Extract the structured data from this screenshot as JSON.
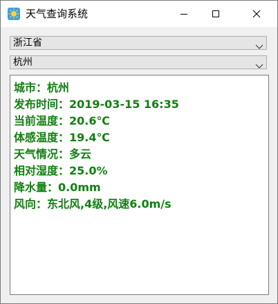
{
  "window": {
    "title": "天气查询系统",
    "icon": "weather-app-icon",
    "controls": {
      "minimize_icon": "minimize-icon",
      "maximize_icon": "maximize-icon",
      "close_icon": "close-icon"
    }
  },
  "province_select": {
    "selected": "浙江省",
    "arrow_icon": "chevron-down-icon"
  },
  "city_select": {
    "selected": "杭州",
    "arrow_icon": "chevron-down-icon"
  },
  "weather_info": {
    "lines": [
      "城市：杭州",
      "发布时间：2019-03-15 16:35",
      "当前温度：20.6℃",
      "体感温度：19.4℃",
      "天气情况：多云",
      "相对湿度：25.0%",
      "降水量：0.0mm",
      "风向：东北风,4级,风速6.0m/s"
    ],
    "text_color": "#108010"
  },
  "colors": {
    "titlebar_bg": "#ffffff",
    "window_bg": "#f0f0f0",
    "combo_bg": "#e5e5e5"
  }
}
